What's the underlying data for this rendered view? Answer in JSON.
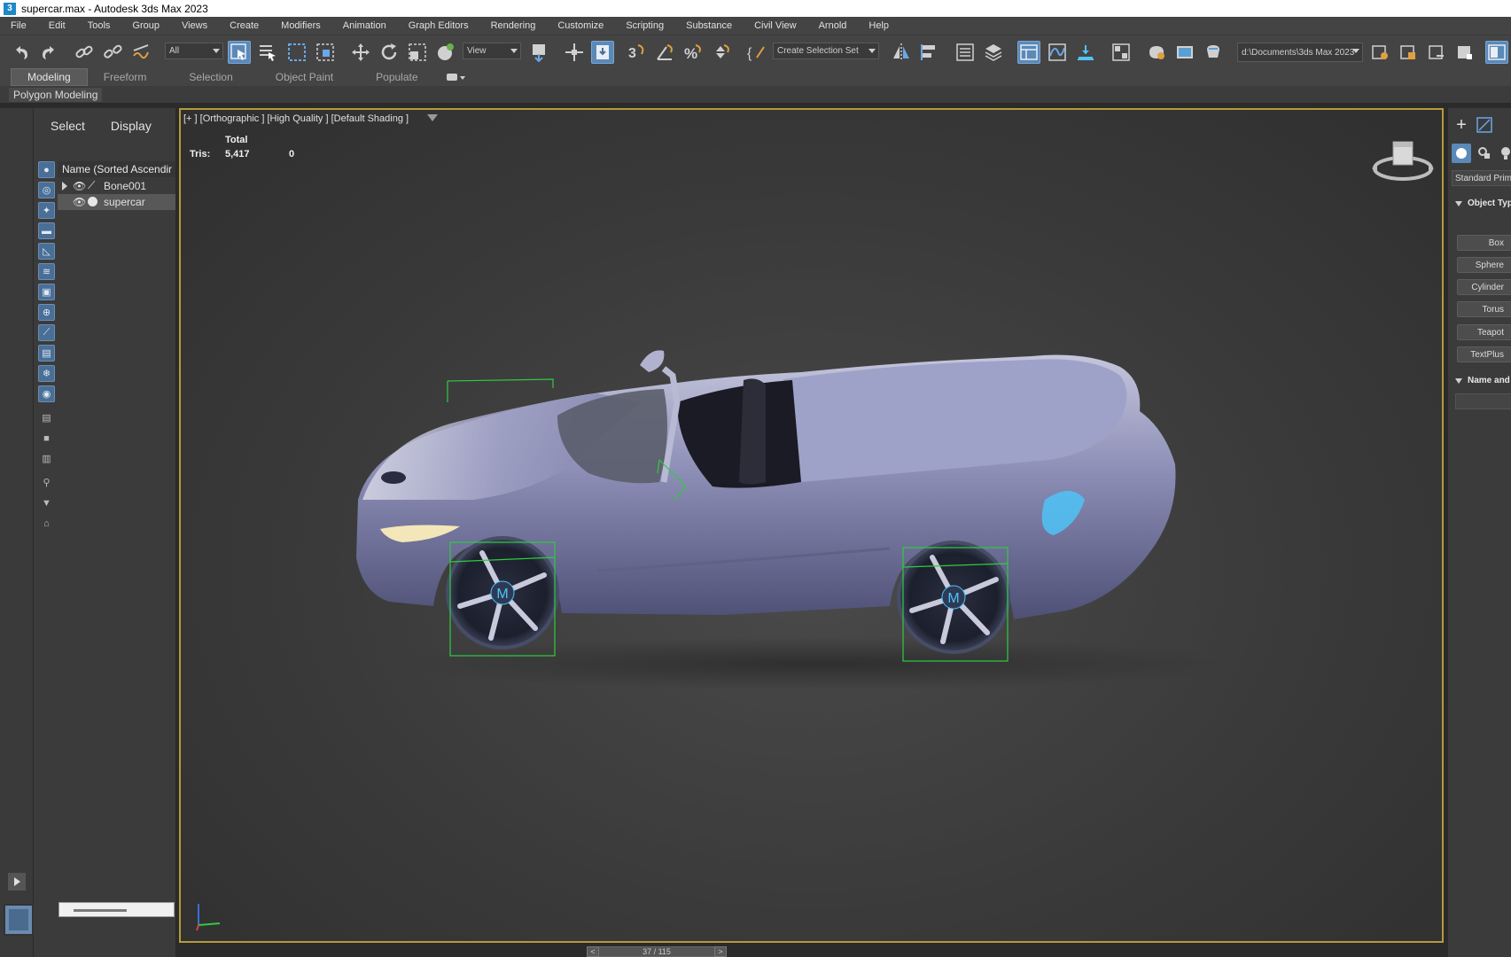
{
  "window": {
    "title": "supercar.max - Autodesk 3ds Max 2023",
    "app_icon": "3"
  },
  "menu": [
    "File",
    "Edit",
    "Tools",
    "Group",
    "Views",
    "Create",
    "Modifiers",
    "Animation",
    "Graph Editors",
    "Rendering",
    "Customize",
    "Scripting",
    "Substance",
    "Civil View",
    "Arnold",
    "Help"
  ],
  "toolbar": {
    "selection_filter": "All",
    "ref_coord": "View",
    "selection_set": "Create Selection Set",
    "project_path": "d:\\Documents\\3ds Max 2023",
    "icons": [
      "undo-icon",
      "redo-icon",
      "link-icon",
      "unlink-icon",
      "bind-spacewarp-icon",
      "select-object-icon",
      "select-by-name-icon",
      "rect-selection-icon",
      "window-crossing-icon",
      "move-icon",
      "rotate-icon",
      "scale-icon",
      "place-icon",
      "select-manipulate-icon",
      "pivot-icon",
      "snap-3d-icon",
      "angle-snap-icon",
      "percent-snap-icon",
      "spinner-snap-icon",
      "edit-named-sets-icon",
      "mirror-icon",
      "align-icon",
      "scene-explorer-icon",
      "layer-explorer-icon",
      "ribbon-toggle-icon",
      "curve-editor-icon",
      "schematic-view-icon",
      "material-editor-icon",
      "render-setup-icon",
      "rendered-frame-icon",
      "render-icon",
      "project-icon",
      "project-open-icon",
      "project-close-icon",
      "project-save-icon",
      "workspace-icon"
    ]
  },
  "ribbon": {
    "tabs": [
      "Modeling",
      "Freeform",
      "Selection",
      "Object Paint",
      "Populate"
    ],
    "active_tab": "Modeling",
    "panel_label": "Polygon Modeling"
  },
  "scene_explorer": {
    "tabs": [
      "Select",
      "Display"
    ],
    "column_header": "Name (Sorted Ascendir",
    "rows": [
      {
        "name": "Bone001",
        "type": "bone",
        "expandable": true,
        "selected": false
      },
      {
        "name": "supercar",
        "type": "geometry",
        "expandable": false,
        "selected": true
      }
    ]
  },
  "viewport": {
    "label": "[+ ] [Orthographic ] [High Quality ] [Default Shading ]",
    "stats": {
      "heading": "Total",
      "tris_label": "Tris:",
      "tris_total": "5,417",
      "tris_selected": "0"
    },
    "wheel_logo": "M"
  },
  "time_slider": {
    "position": "37 / 115",
    "prev": "<",
    "next": ">"
  },
  "command_panel": {
    "dropdown": "Standard Primitives",
    "rollouts": [
      "Object Type",
      "Name and Color"
    ],
    "buttons": [
      "Box",
      "Sphere",
      "Cylinder",
      "Torus",
      "Teapot",
      "TextPlus"
    ]
  },
  "colors": {
    "accent": "#5b89b8",
    "viewport_border": "#b59a3c",
    "bone_box": "#2ecc40",
    "car_body": "#7a7fa8"
  }
}
